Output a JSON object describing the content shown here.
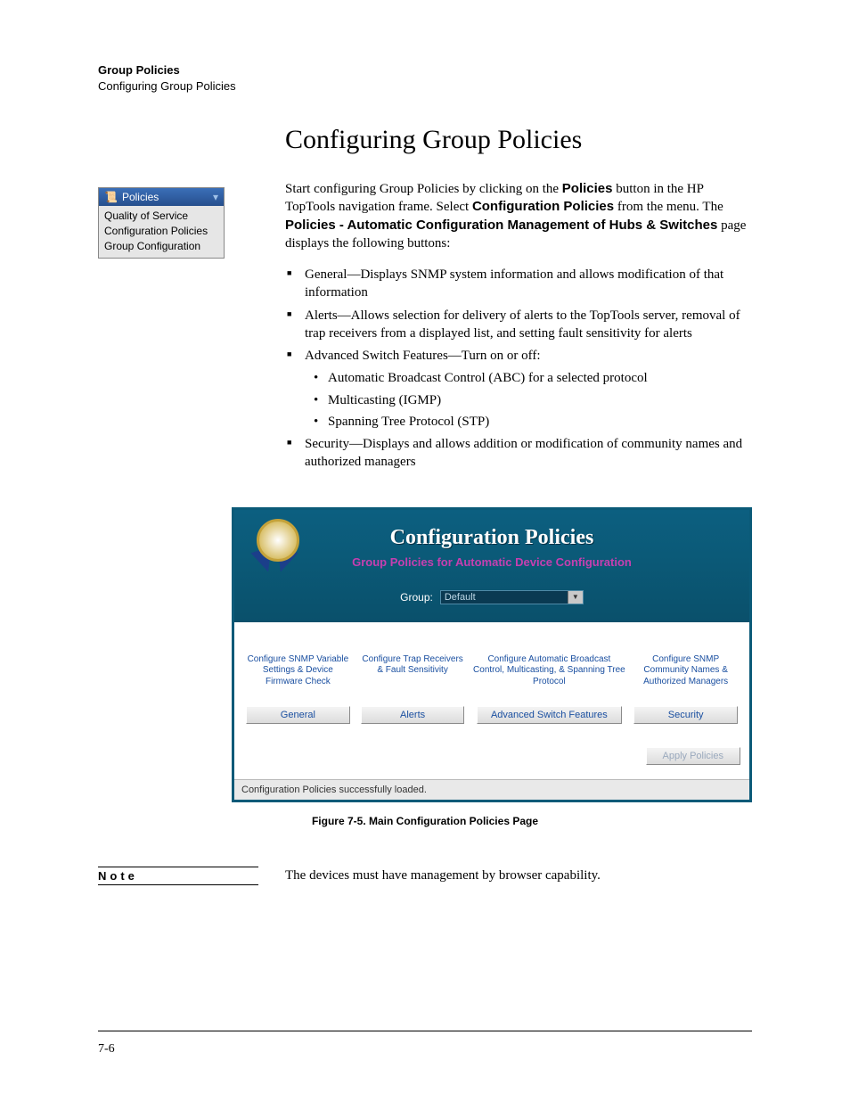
{
  "header": {
    "line1": "Group Policies",
    "line2": "Configuring Group Policies"
  },
  "section_title": "Configuring Group Policies",
  "intro": {
    "seg1": "Start configuring Group Policies by clicking on the ",
    "bold1": "Policies",
    "seg2": " button in the HP TopTools navigation frame. Select ",
    "bold2": "Configuration Policies",
    "seg3": " from the menu. The ",
    "bold3": "Policies - Automatic Configuration Management of Hubs & Switches",
    "seg4": " page displays the following buttons:"
  },
  "list": {
    "b1": "General—Displays SNMP system information and allows modification of that information",
    "b2": "Alerts—Allows selection for delivery of alerts to the TopTools server, removal of trap receivers from a displayed list, and setting fault sensitivity for alerts",
    "b3": "Advanced Switch Features—Turn on or off:",
    "b3a": "Automatic Broadcast Control (ABC) for a selected protocol",
    "b3b": "Multicasting (IGMP)",
    "b3c": "Spanning Tree Protocol (STP)",
    "b4": "Security—Displays and allows addition or modification of community names and authorized managers"
  },
  "side_menu": {
    "title": "Policies",
    "items": [
      "Quality of Service",
      "Configuration Policies",
      "Group Configuration"
    ]
  },
  "shot": {
    "title": "Configuration Policies",
    "subtitle": "Group Policies for Automatic Device Configuration",
    "group_label": "Group:",
    "group_value": "Default",
    "columns": [
      {
        "desc": "Configure SNMP Variable Settings & Device Firmware Check",
        "button": "General"
      },
      {
        "desc": "Configure Trap Receivers & Fault Sensitivity",
        "button": "Alerts"
      },
      {
        "desc": "Configure Automatic Broadcast Control, Multicasting, & Spanning Tree Protocol",
        "button": "Advanced Switch Features"
      },
      {
        "desc": "Configure SNMP Community Names & Authorized Managers",
        "button": "Security"
      }
    ],
    "apply_label": "Apply Policies",
    "status": "Configuration Policies successfully loaded."
  },
  "figure_caption": "Figure 7-5.   Main Configuration Policies Page",
  "note": {
    "label": "Note",
    "text": "The devices must have management by browser capability."
  },
  "page_number": "7-6"
}
